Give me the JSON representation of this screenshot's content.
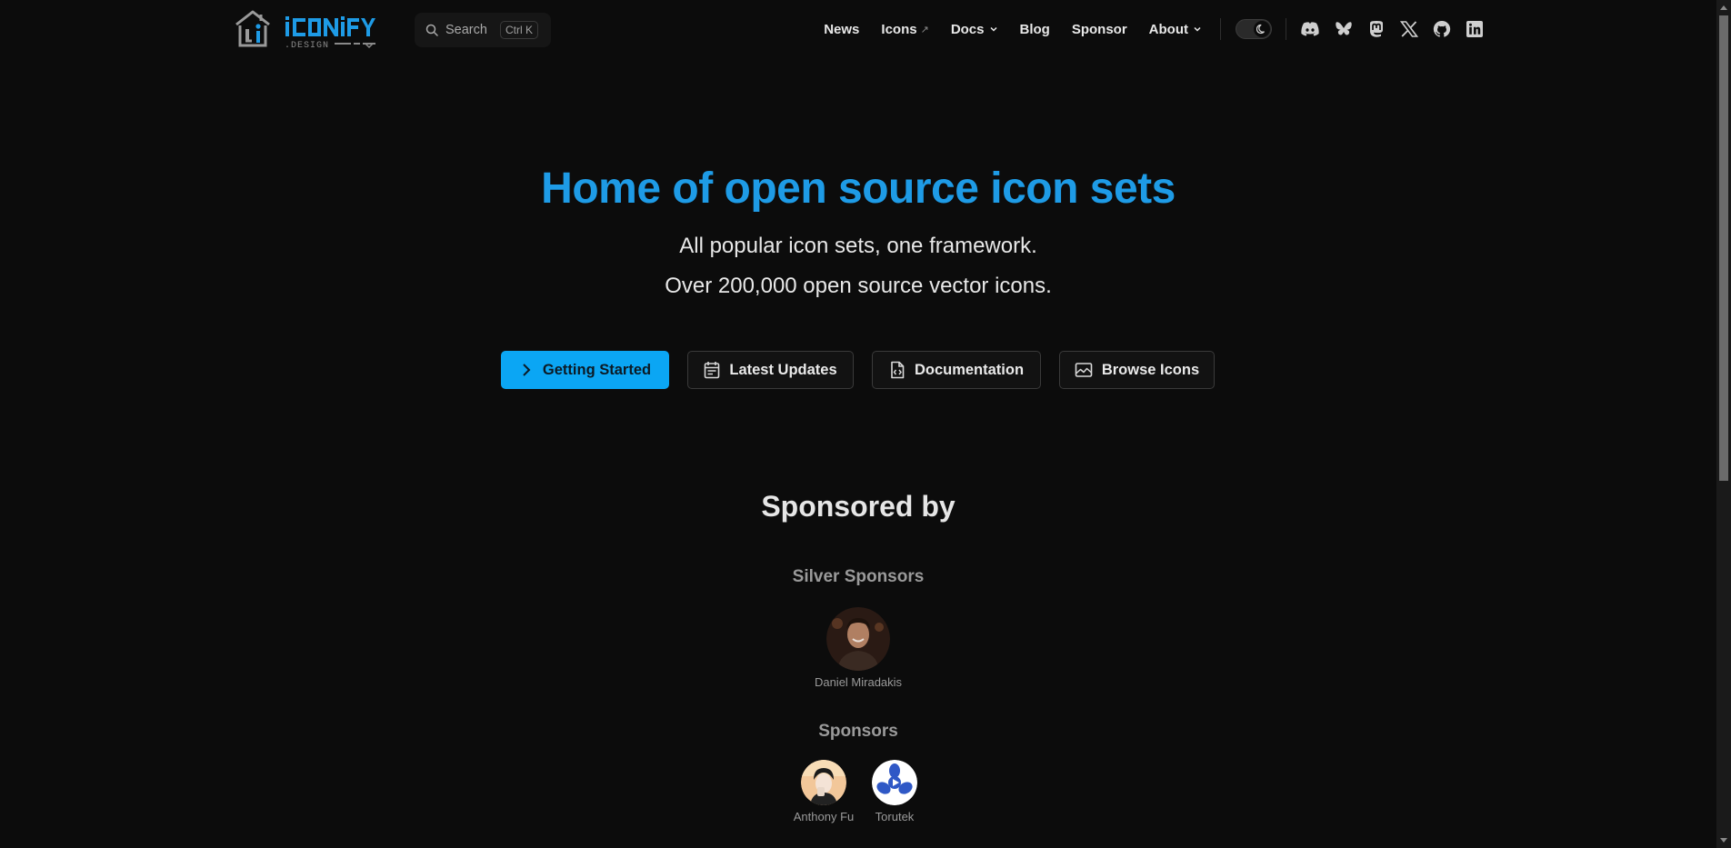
{
  "header": {
    "logo_alt": "Iconify.Design",
    "search": {
      "label": "Search",
      "shortcut": "Ctrl K"
    },
    "nav": [
      {
        "label": "News"
      },
      {
        "label": "Icons",
        "external": "↗"
      },
      {
        "label": "Docs"
      },
      {
        "label": "Blog"
      },
      {
        "label": "Sponsor"
      },
      {
        "label": "About"
      }
    ],
    "theme_toggle": "dark-mode-toggle",
    "social_icons": [
      "discord-icon",
      "bluesky-icon",
      "mastodon-icon",
      "x-icon",
      "github-icon",
      "linkedin-icon"
    ]
  },
  "hero": {
    "title": "Home of open source icon sets",
    "subtitle_1": "All popular icon sets, one framework.",
    "subtitle_2": "Over 200,000 open source vector icons.",
    "buttons": [
      {
        "label": "Getting Started",
        "icon": "chevron-right-icon"
      },
      {
        "label": "Latest Updates",
        "icon": "calendar-icon"
      },
      {
        "label": "Documentation",
        "icon": "code-file-icon"
      },
      {
        "label": "Browse Icons",
        "icon": "image-icon"
      }
    ]
  },
  "sponsors": {
    "title": "Sponsored by",
    "silver_title": "Silver Sponsors",
    "silver": [
      {
        "name": "Daniel Miradakis"
      }
    ],
    "regular_title": "Sponsors",
    "regular": [
      {
        "name": "Anthony Fu"
      },
      {
        "name": "Torutek"
      }
    ]
  },
  "colors": {
    "background": "#0c0c0c",
    "accent": "#1e9be6",
    "primary_button": "#0ba6f4",
    "text": "#e6e6e6",
    "muted": "#9a9a9a"
  }
}
